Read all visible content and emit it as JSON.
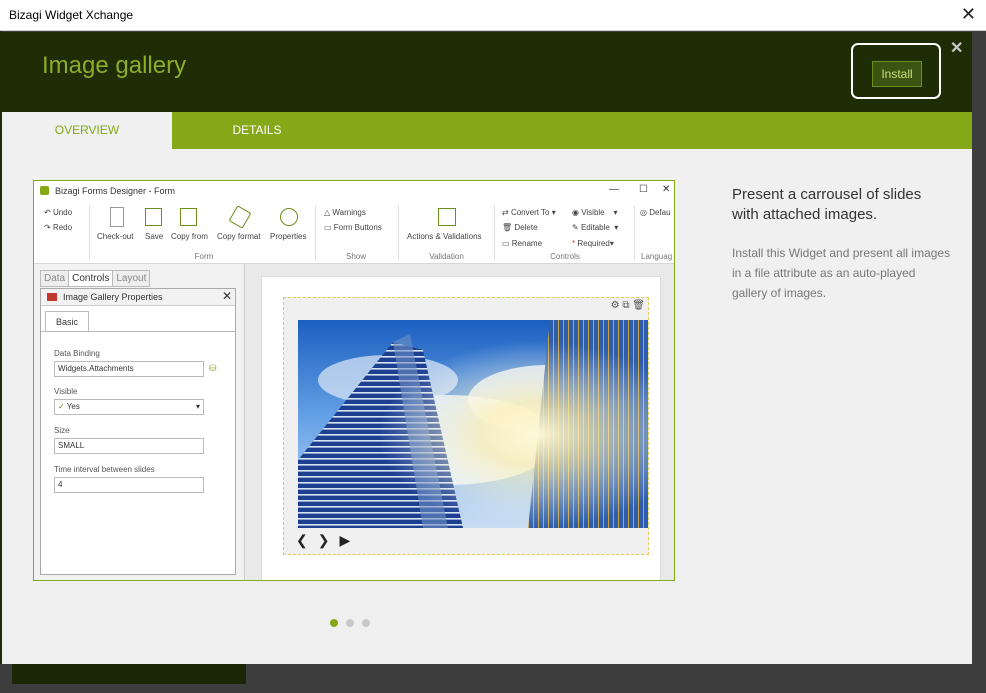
{
  "window": {
    "title": "Bizagi Widget Xchange",
    "close_glyph": "✕"
  },
  "header": {
    "title": "Image gallery",
    "install_label": "Install",
    "close_glyph": "✕"
  },
  "tabs": [
    {
      "label": "OVERVIEW",
      "active": true
    },
    {
      "label": "DETAILS",
      "active": false
    }
  ],
  "preview": {
    "app_title": "Bizagi Forms Designer  -  Form",
    "window_controls": [
      "—",
      "☐",
      "✕"
    ],
    "ribbon": {
      "undo": "Undo",
      "redo": "Redo",
      "form_items": [
        "Check-out",
        "Save",
        "Copy from",
        "Copy format",
        "Properties"
      ],
      "form_group": "Form",
      "show_items": [
        "Warnings",
        "Form Buttons"
      ],
      "show_group": "Show",
      "validation_item": "Actions & Validations",
      "validation_group": "Validation",
      "controls_items": [
        "Convert To",
        "Delete",
        "Rename",
        "Visible",
        "Editable",
        "Required"
      ],
      "controls_group": "Controls",
      "language_item": "Defau",
      "language_group": "Languag"
    },
    "panel_tabs": [
      "Data",
      "Controls",
      "Layout"
    ],
    "properties": {
      "title": "Image Gallery Properties",
      "tab": "Basic",
      "fields": [
        {
          "label": "Data Binding",
          "value": "Widgets.Attachments"
        },
        {
          "label": "Visible",
          "value": "Yes"
        },
        {
          "label": "Size",
          "value": "SMALL"
        },
        {
          "label": "Time interval between slides",
          "value": "4"
        }
      ]
    }
  },
  "description": {
    "headline": "Present a carrousel of slides with attached images.",
    "body": "Install this Widget and present all images in a file attribute as an auto-played gallery of images."
  },
  "carousel": {
    "total": 3,
    "active_index": 0
  },
  "colors": {
    "accent": "#85a819",
    "header_bg": "#1f2d07",
    "title_green": "#8dac28"
  }
}
